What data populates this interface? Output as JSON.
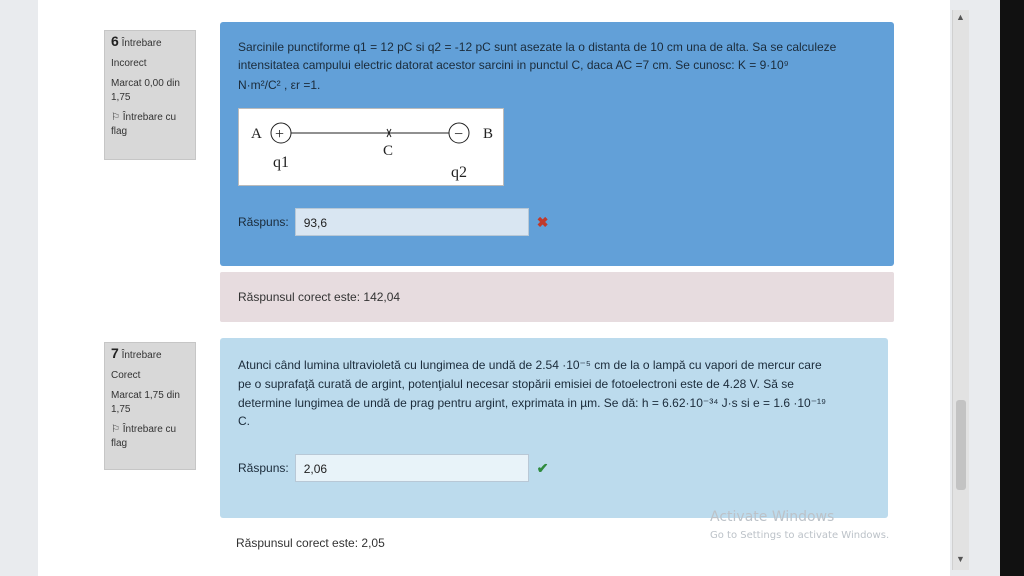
{
  "q6": {
    "number": "6",
    "word": "Întrebare",
    "status": "Incorect",
    "mark": "Marcat 0,00 din 1,75",
    "flag": "Întrebare cu flag",
    "text_line1": "Sarcinile punctiforme q1 = 12 pC si q2 = -12 pC sunt asezate la o distanta de 10 cm una de alta. Sa se calculeze",
    "text_line2": "intensitatea campului electric datorat acestor sarcini  in punctul C, daca AC =7 cm. Se cunosc: K = 9·10⁹",
    "text_line3": "N·m²/C² , εr =1.",
    "figure": {
      "label_a": "A",
      "label_b": "B",
      "label_c": "C",
      "label_q1": "q1",
      "label_q2": "q2",
      "plus": "+",
      "minus": "−"
    },
    "answer_label": "Răspuns:",
    "answer_value": "93,6",
    "answer_icon": "cross-icon",
    "answer_icon_color": "#c0392b",
    "correct_answer": "Răspunsul corect este: 142,04"
  },
  "q7": {
    "number": "7",
    "word": "Întrebare",
    "status": "Corect",
    "mark": "Marcat 1,75 din 1,75",
    "flag": "Întrebare cu flag",
    "text_line1": "Atunci când lumina ultravioletă cu lungimea de undă de 2.54 ·10⁻⁵ cm de la o lampă cu vapori de  mercur care",
    "text_line2": "pe o suprafaţă curată de argint, potenţialul necesar stopării emisiei de fotoelectroni este de 4.28 V. Să se",
    "text_line3": "determine lungimea de undă de prag pentru argint, exprimata in µm.  Se dă: h = 6.62·10⁻³⁴ J·s si e = 1.6 ·10⁻¹⁹",
    "text_line4": "C.",
    "answer_label": "Răspuns:",
    "answer_value": "2,06",
    "answer_icon": "check-icon",
    "answer_icon_color": "#2e8b3e",
    "correct_answer": "Răspunsul corect este: 2,05"
  },
  "watermark": {
    "line1": "Activate Windows",
    "line2": "Go to Settings to activate Windows."
  },
  "colors": {
    "q6_bg": "#62a0d8",
    "q7_bg": "#bcdbed",
    "feedback_bg": "#e7dcdf"
  }
}
